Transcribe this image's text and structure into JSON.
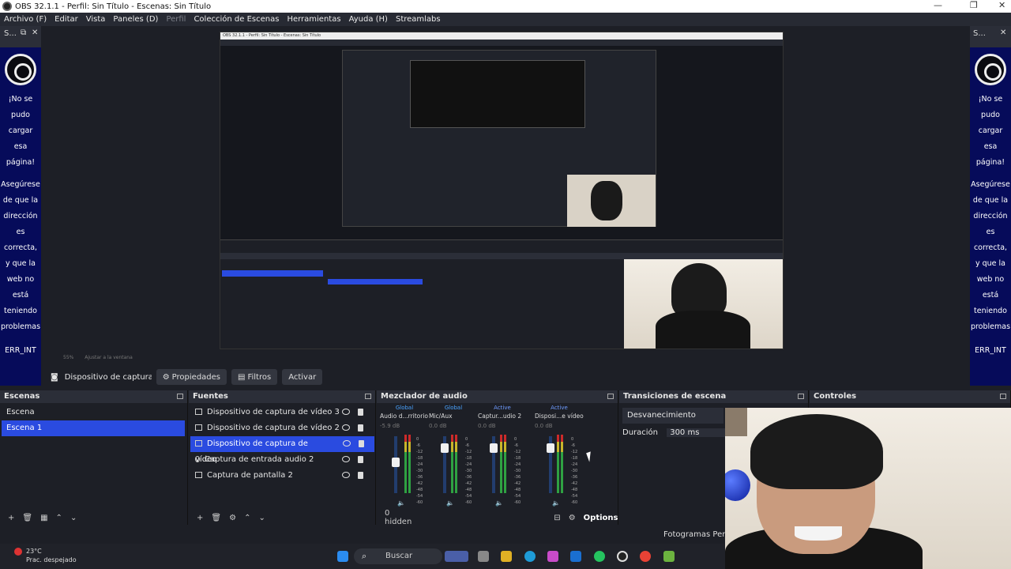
{
  "window": {
    "title": "OBS 32.1.1 - Perfil: Sin Título - Escenas: Sin Título"
  },
  "menu": {
    "items": [
      "Archivo (F)",
      "Editar",
      "Vista",
      "Paneles (D)",
      "Perfil",
      "Colección de Escenas",
      "Herramientas",
      "Ayuda (H)",
      "Streamlabs"
    ]
  },
  "side_dock": {
    "title": "S...",
    "error_lines": [
      "¡No se",
      "pudo",
      "cargar",
      "esa",
      "página!",
      "Asegúrese",
      "de que la",
      "dirección",
      "es",
      "correcta,",
      "y que la",
      "web no",
      "está",
      "teniendo",
      "problemas"
    ],
    "error_code": "ERR_INT"
  },
  "zoom": {
    "value": "55%",
    "fit": "Ajustar a la ventana"
  },
  "source_toolbar": {
    "source": "Dispositivo de captura de v",
    "properties": "Propiedades",
    "filters": "Filtros",
    "activate": "Activar"
  },
  "scenes": {
    "title": "Escenas",
    "items": [
      "Escena",
      "Escena 1"
    ],
    "selected": 1
  },
  "sources": {
    "title": "Fuentes",
    "items": [
      {
        "name": "Dispositivo de captura de vídeo 3",
        "icon": "camera-icon"
      },
      {
        "name": "Dispositivo de captura de vídeo 2",
        "icon": "camera-icon"
      },
      {
        "name": "Dispositivo de captura de vídeo",
        "icon": "camera-icon"
      },
      {
        "name": "Captura de entrada audio 2",
        "icon": "mic-icon"
      },
      {
        "name": "Captura de pantalla 2",
        "icon": "monitor-icon"
      }
    ],
    "selected": 2
  },
  "mixer": {
    "title": "Mezclador de audio",
    "channels": [
      {
        "top": "Global",
        "name": "Audio d...rritorio",
        "db": "-5.9 dB",
        "level": 0.55
      },
      {
        "top": "Global",
        "name": "Mic/Aux",
        "db": "0.0 dB",
        "level": 0.85
      },
      {
        "top": "Active",
        "name": "Captur...udio 2",
        "db": "0.0 dB",
        "level": 0.85
      },
      {
        "top": "Active",
        "name": "Disposi...e vídeo",
        "db": "0.0 dB",
        "level": 0.85
      }
    ],
    "scale": [
      "0",
      "-6",
      "-12",
      "-18",
      "-24",
      "-30",
      "-36",
      "-42",
      "-48",
      "-54",
      "-60"
    ],
    "hidden": "0 hidden",
    "options": "Options"
  },
  "transitions": {
    "title": "Transiciones de escena",
    "type": "Desvanecimiento",
    "duration_label": "Duración",
    "duration": "300 ms"
  },
  "controls": {
    "title": "Controles"
  },
  "status": {
    "dropped": "Fotogramas Perdid"
  },
  "taskbar": {
    "search": "Buscar",
    "temp": "23°C",
    "weather": "Prac. despejado"
  },
  "colors": {
    "accent": "#2a4be0",
    "panel": "#1d1f26",
    "header": "#2b2e38",
    "dock_bg": "#060b5a"
  }
}
